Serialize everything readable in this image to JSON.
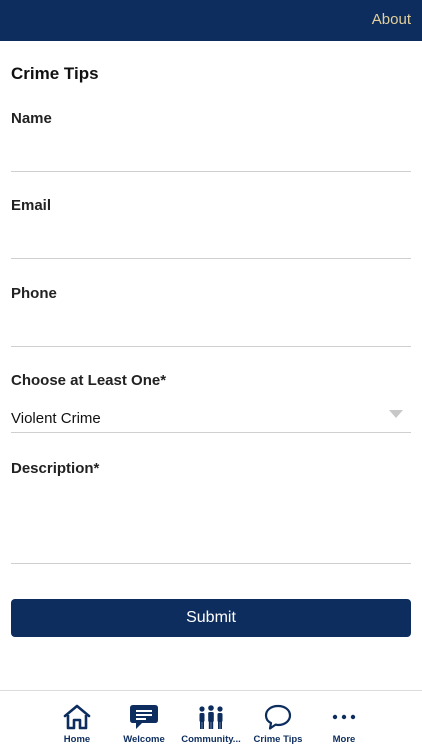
{
  "header": {
    "about_label": "About"
  },
  "page": {
    "title": "Crime Tips"
  },
  "form": {
    "name": {
      "label": "Name",
      "value": ""
    },
    "email": {
      "label": "Email",
      "value": ""
    },
    "phone": {
      "label": "Phone",
      "value": ""
    },
    "category": {
      "label": "Choose at Least One*",
      "selected": "Violent Crime"
    },
    "description": {
      "label": "Description*",
      "value": ""
    },
    "submit_label": "Submit"
  },
  "bottom_nav": {
    "items": [
      {
        "label": "Home",
        "icon": "home-icon"
      },
      {
        "label": "Welcome",
        "icon": "speech-bubble-icon"
      },
      {
        "label": "Community...",
        "icon": "people-icon"
      },
      {
        "label": "Crime Tips",
        "icon": "chat-outline-icon"
      },
      {
        "label": "More",
        "icon": "more-dots-icon"
      }
    ]
  },
  "colors": {
    "primary": "#0c2d5e",
    "header_link": "#e3cf9a",
    "divider": "#cfcfcf"
  }
}
